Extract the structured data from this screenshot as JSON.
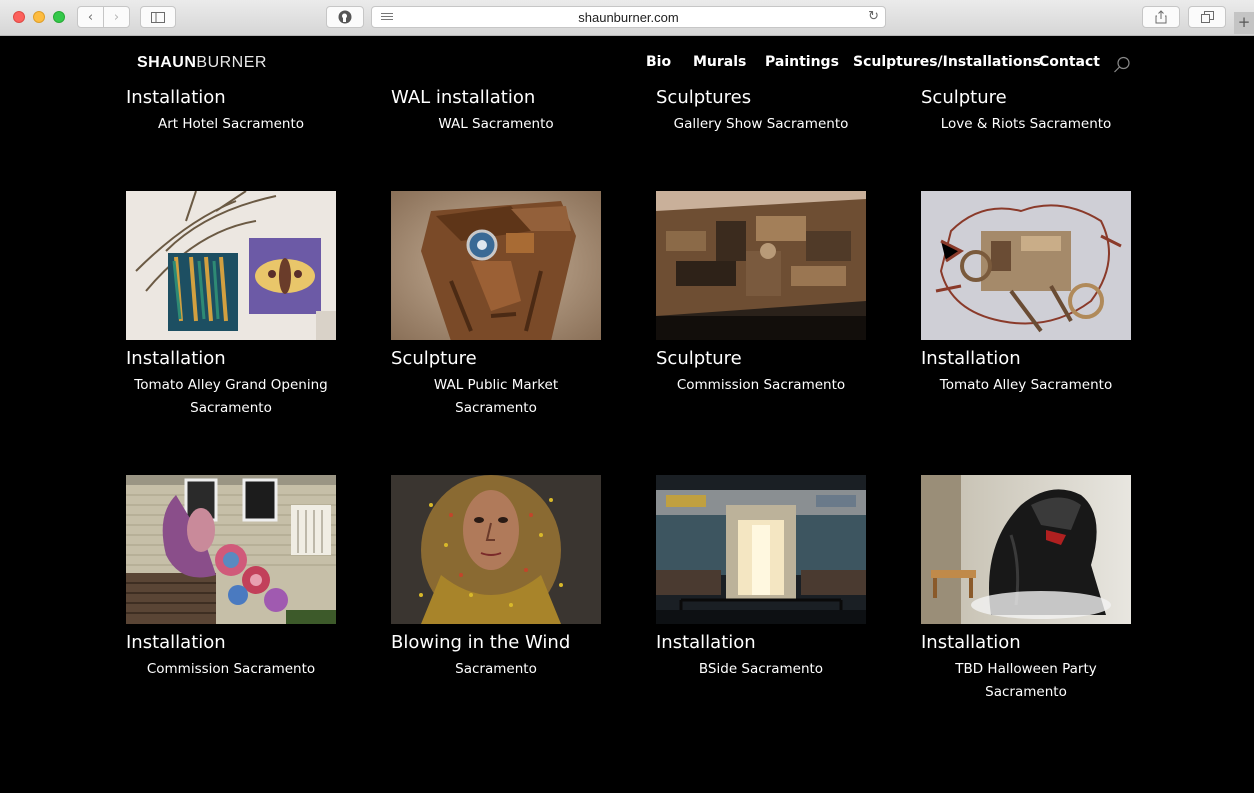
{
  "browser": {
    "url": "shaunburner.com"
  },
  "site": {
    "logo_bold": "SHAUN",
    "logo_light": "BURNER",
    "nav": [
      "Bio",
      "Murals",
      "Paintings",
      "Sculptures/Installations",
      "Contact"
    ]
  },
  "top_row": [
    {
      "title": "Installation",
      "subtitle": "Art Hotel Sacramento"
    },
    {
      "title": "WAL installation",
      "subtitle": "WAL Sacramento"
    },
    {
      "title": "Sculptures",
      "subtitle": "Gallery Show Sacramento"
    },
    {
      "title": "Sculpture",
      "subtitle": "Love & Riots Sacramento"
    }
  ],
  "middle_row": [
    {
      "title": "Installation",
      "subtitle_lines": [
        "Tomato Alley Grand Opening",
        "Sacramento"
      ]
    },
    {
      "title": "Sculpture",
      "subtitle_lines": [
        "WAL Public Market Sacramento"
      ]
    },
    {
      "title": "Sculpture",
      "subtitle_lines": [
        "Commission Sacramento"
      ]
    },
    {
      "title": "Installation",
      "subtitle_lines": [
        "Tomato Alley Sacramento"
      ]
    }
  ],
  "bottom_row": [
    {
      "title": "Installation",
      "subtitle_lines": [
        "Commission Sacramento"
      ]
    },
    {
      "title": "Blowing in the Wind",
      "subtitle_lines": [
        "Sacramento"
      ]
    },
    {
      "title": "Installation",
      "subtitle_lines": [
        "BSide Sacramento"
      ]
    },
    {
      "title": "Installation",
      "subtitle_lines": [
        "TBD Halloween Party",
        "Sacramento"
      ]
    }
  ]
}
